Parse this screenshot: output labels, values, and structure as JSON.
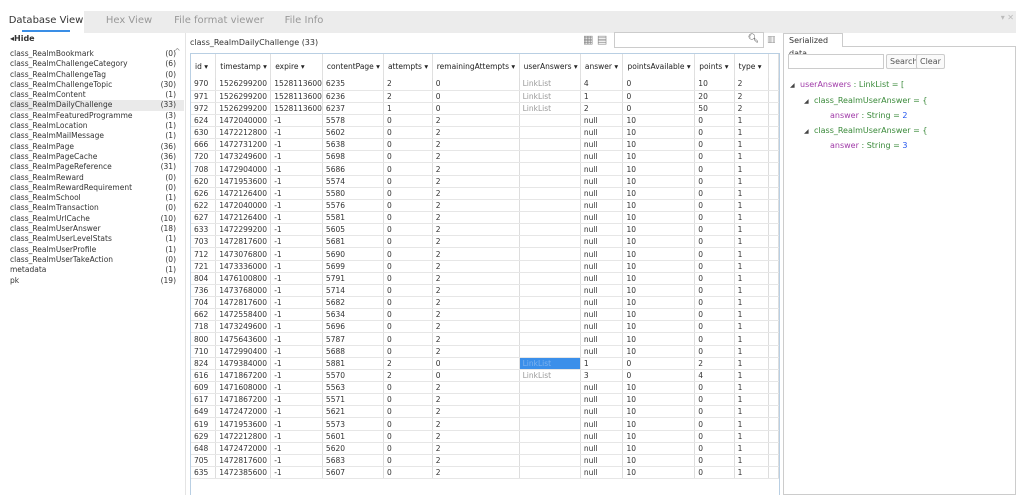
{
  "tabs": [
    "Database View",
    "Hex View",
    "File format viewer",
    "File Info"
  ],
  "hide_label": "Hide",
  "sidebar": [
    [
      "class_RealmBookmark",
      "(0)"
    ],
    [
      "class_RealmChallengeCategory",
      "(6)"
    ],
    [
      "class_RealmChallengeTag",
      "(0)"
    ],
    [
      "class_RealmChallengeTopic",
      "(30)"
    ],
    [
      "class_RealmContent",
      "(1)"
    ],
    [
      "class_RealmDailyChallenge",
      "(33)"
    ],
    [
      "class_RealmFeaturedProgramme",
      "(3)"
    ],
    [
      "class_RealmLocation",
      "(1)"
    ],
    [
      "class_RealmMailMessage",
      "(1)"
    ],
    [
      "class_RealmPage",
      "(36)"
    ],
    [
      "class_RealmPageCache",
      "(36)"
    ],
    [
      "class_RealmPageReference",
      "(31)"
    ],
    [
      "class_RealmReward",
      "(0)"
    ],
    [
      "class_RealmRewardRequirement",
      "(0)"
    ],
    [
      "class_RealmSchool",
      "(1)"
    ],
    [
      "class_RealmTransaction",
      "(0)"
    ],
    [
      "class_RealmUrlCache",
      "(10)"
    ],
    [
      "class_RealmUserAnswer",
      "(18)"
    ],
    [
      "class_RealmUserLevelStats",
      "(1)"
    ],
    [
      "class_RealmUserProfile",
      "(1)"
    ],
    [
      "class_RealmUserTakeAction",
      "(0)"
    ],
    [
      "metadata",
      "(1)"
    ],
    [
      "pk",
      "(19)"
    ]
  ],
  "table": {
    "title": "class_RealmDailyChallenge",
    "count": "(33)",
    "columns": [
      "id ▾",
      "timestamp ▾",
      "expire ▾",
      "contentPage ▾",
      "attempts ▾",
      "remainingAttempts ▾",
      "userAnswers ▾",
      "answer ▾",
      "pointsAvailable ▾",
      "points ▾",
      "type ▾"
    ],
    "rows": [
      [
        "970",
        "1526299200",
        "1528113600",
        "6235",
        "2",
        "0",
        "LinkList",
        "4",
        "0",
        "10",
        "2"
      ],
      [
        "971",
        "1526299200",
        "1528113600",
        "6236",
        "2",
        "0",
        "LinkList",
        "1",
        "0",
        "20",
        "2"
      ],
      [
        "972",
        "1526299200",
        "1528113600",
        "6237",
        "1",
        "0",
        "LinkList",
        "2",
        "0",
        "50",
        "2"
      ],
      [
        "624",
        "1472040000",
        "-1",
        "5578",
        "0",
        "2",
        "",
        "null",
        "10",
        "0",
        "1"
      ],
      [
        "630",
        "1472212800",
        "-1",
        "5602",
        "0",
        "2",
        "",
        "null",
        "10",
        "0",
        "1"
      ],
      [
        "666",
        "1472731200",
        "-1",
        "5638",
        "0",
        "2",
        "",
        "null",
        "10",
        "0",
        "1"
      ],
      [
        "720",
        "1473249600",
        "-1",
        "5698",
        "0",
        "2",
        "",
        "null",
        "10",
        "0",
        "1"
      ],
      [
        "708",
        "1472904000",
        "-1",
        "5686",
        "0",
        "2",
        "",
        "null",
        "10",
        "0",
        "1"
      ],
      [
        "620",
        "1471953600",
        "-1",
        "5574",
        "0",
        "2",
        "",
        "null",
        "10",
        "0",
        "1"
      ],
      [
        "626",
        "1472126400",
        "-1",
        "5580",
        "0",
        "2",
        "",
        "null",
        "10",
        "0",
        "1"
      ],
      [
        "622",
        "1472040000",
        "-1",
        "5576",
        "0",
        "2",
        "",
        "null",
        "10",
        "0",
        "1"
      ],
      [
        "627",
        "1472126400",
        "-1",
        "5581",
        "0",
        "2",
        "",
        "null",
        "10",
        "0",
        "1"
      ],
      [
        "633",
        "1472299200",
        "-1",
        "5605",
        "0",
        "2",
        "",
        "null",
        "10",
        "0",
        "1"
      ],
      [
        "703",
        "1472817600",
        "-1",
        "5681",
        "0",
        "2",
        "",
        "null",
        "10",
        "0",
        "1"
      ],
      [
        "712",
        "1473076800",
        "-1",
        "5690",
        "0",
        "2",
        "",
        "null",
        "10",
        "0",
        "1"
      ],
      [
        "721",
        "1473336000",
        "-1",
        "5699",
        "0",
        "2",
        "",
        "null",
        "10",
        "0",
        "1"
      ],
      [
        "804",
        "1476100800",
        "-1",
        "5791",
        "0",
        "2",
        "",
        "null",
        "10",
        "0",
        "1"
      ],
      [
        "736",
        "1473768000",
        "-1",
        "5714",
        "0",
        "2",
        "",
        "null",
        "10",
        "0",
        "1"
      ],
      [
        "704",
        "1472817600",
        "-1",
        "5682",
        "0",
        "2",
        "",
        "null",
        "10",
        "0",
        "1"
      ],
      [
        "662",
        "1472558400",
        "-1",
        "5634",
        "0",
        "2",
        "",
        "null",
        "10",
        "0",
        "1"
      ],
      [
        "718",
        "1473249600",
        "-1",
        "5696",
        "0",
        "2",
        "",
        "null",
        "10",
        "0",
        "1"
      ],
      [
        "800",
        "1475643600",
        "-1",
        "5787",
        "0",
        "2",
        "",
        "null",
        "10",
        "0",
        "1"
      ],
      [
        "710",
        "1472990400",
        "-1",
        "5688",
        "0",
        "2",
        "",
        "null",
        "10",
        "0",
        "1"
      ],
      [
        "824",
        "1479384000",
        "-1",
        "5881",
        "2",
        "0",
        "LinkList",
        "1",
        "0",
        "2",
        "1"
      ],
      [
        "616",
        "1471867200",
        "-1",
        "5570",
        "2",
        "0",
        "LinkList",
        "3",
        "0",
        "4",
        "1"
      ],
      [
        "609",
        "1471608000",
        "-1",
        "5563",
        "0",
        "2",
        "",
        "null",
        "10",
        "0",
        "1"
      ],
      [
        "617",
        "1471867200",
        "-1",
        "5571",
        "0",
        "2",
        "",
        "null",
        "10",
        "0",
        "1"
      ],
      [
        "649",
        "1472472000",
        "-1",
        "5621",
        "0",
        "2",
        "",
        "null",
        "10",
        "0",
        "1"
      ],
      [
        "619",
        "1471953600",
        "-1",
        "5573",
        "0",
        "2",
        "",
        "null",
        "10",
        "0",
        "1"
      ],
      [
        "629",
        "1472212800",
        "-1",
        "5601",
        "0",
        "2",
        "",
        "null",
        "10",
        "0",
        "1"
      ],
      [
        "648",
        "1472472000",
        "-1",
        "5620",
        "0",
        "2",
        "",
        "null",
        "10",
        "0",
        "1"
      ],
      [
        "705",
        "1472817600",
        "-1",
        "5683",
        "0",
        "2",
        "",
        "null",
        "10",
        "0",
        "1"
      ],
      [
        "635",
        "1472385600",
        "-1",
        "5607",
        "0",
        "2",
        "",
        "null",
        "10",
        "0",
        "1"
      ]
    ],
    "selected_row": 23
  },
  "panel": {
    "tab": "Serialized data",
    "search_label": "Search",
    "clear_label": "Clear",
    "search_value": "",
    "tree": {
      "root_name": "userAnswers",
      "root_type": " : LinkList = [",
      "items": [
        {
          "cls": "class_RealmUserAnswer = {",
          "field": "answer",
          "type": " : String = ",
          "value": "2"
        },
        {
          "cls": "class_RealmUserAnswer = {",
          "field": "answer",
          "type": " : String = ",
          "value": "3"
        }
      ]
    }
  }
}
